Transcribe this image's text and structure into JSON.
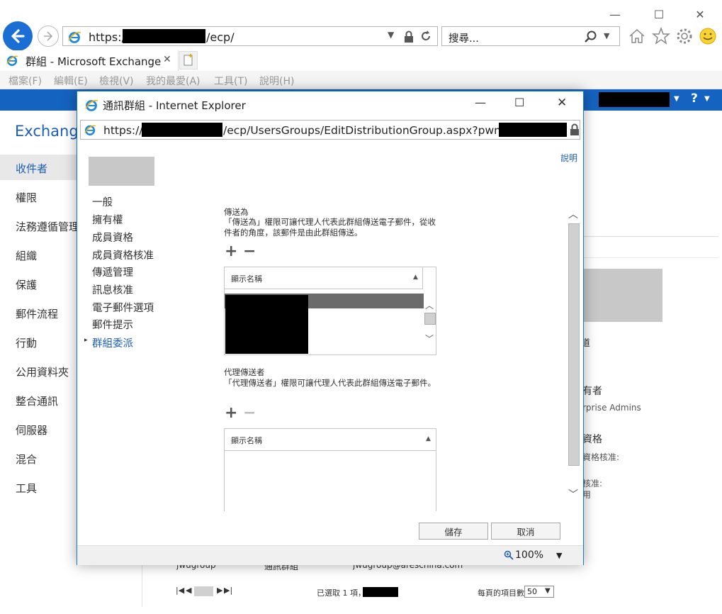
{
  "browser": {
    "url_prefix": "https://",
    "url_suffix": "/ecp/",
    "search_placeholder": "搜尋...",
    "tab_title": "群組 - Microsoft Exchange",
    "tab_close": "✕",
    "menu": [
      "檔案(F)",
      "編輯(E)",
      "檢視(V)",
      "我的最愛(A)",
      "工具(T)",
      "說明(H)"
    ]
  },
  "ecp": {
    "title": "Exchange",
    "help_menu": "?",
    "nav": [
      "收件者",
      "權限",
      "法務遵循管理",
      "組織",
      "保護",
      "郵件流程",
      "行動",
      "公用資料夾",
      "整合通訊",
      "伺服器",
      "混合",
      "工具"
    ],
    "background_text": {
      "owner_heading": "有者",
      "owner_value": "rprise Admins",
      "membership_heading": "資格",
      "membership_value": "資格核准:",
      "approval_value": "核准:",
      "approval_value2": "用",
      "truncated_label": "道",
      "row_name": "jwugroup",
      "row_type": "通訊群組",
      "row_email": "jwugroup@areschina.com",
      "selected_text": "已選取 1 項，",
      "per_page_label": "每頁的項目數",
      "per_page_value": "50"
    }
  },
  "modal": {
    "title": "通訊群組 - Internet Explorer",
    "url_prefix": "https://",
    "url_middle": "/ecp/UsersGroups/EditDistributionGroup.aspx?pwmcid=",
    "help": "說明",
    "sections": [
      "一般",
      "擁有權",
      "成員資格",
      "成員資格核准",
      "傳遞管理",
      "訊息核准",
      "電子郵件選項",
      "郵件提示",
      "群組委派"
    ],
    "active_section_marker": "▸",
    "send_as": {
      "heading": "傳送為",
      "description": "「傳送為」權限可讓代理人代表此群組傳送電子郵件，從收件者的角度，該郵件是由此群組傳送。",
      "column": "顯示名稱"
    },
    "send_on_behalf": {
      "heading": "代理傳送者",
      "description": "「代理傳送者」權限可讓代理人代表此群組傳送電子郵件。",
      "column": "顯示名稱"
    },
    "add_symbol": "+",
    "remove_symbol": "−",
    "save_label": "儲存",
    "cancel_label": "取消",
    "zoom": "100%"
  },
  "colors": {
    "accent": "#1563c0",
    "link": "#1a5fb4",
    "back_button": "#1b6fd4"
  }
}
